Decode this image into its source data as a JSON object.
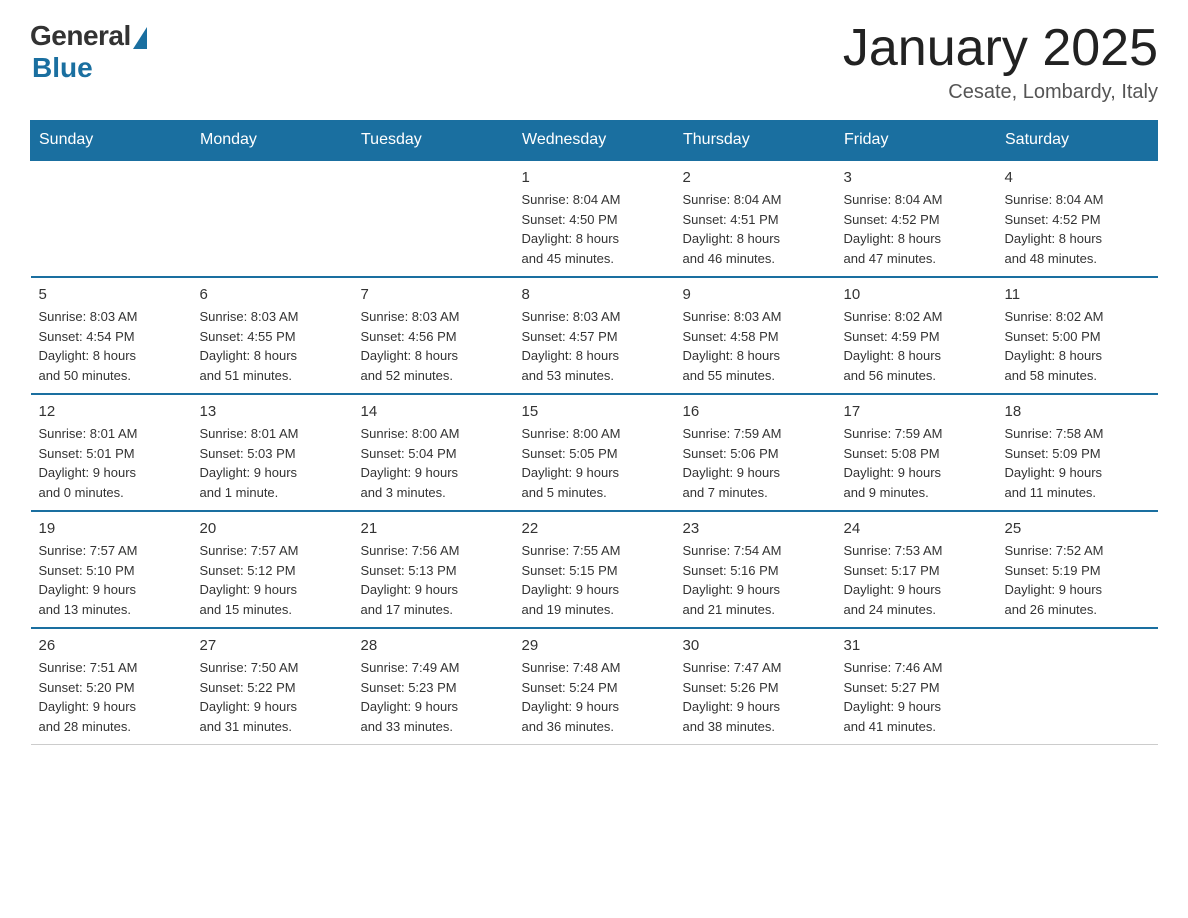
{
  "logo": {
    "general": "General",
    "blue": "Blue"
  },
  "title": "January 2025",
  "location": "Cesate, Lombardy, Italy",
  "days_header": [
    "Sunday",
    "Monday",
    "Tuesday",
    "Wednesday",
    "Thursday",
    "Friday",
    "Saturday"
  ],
  "weeks": [
    [
      {
        "num": "",
        "info": ""
      },
      {
        "num": "",
        "info": ""
      },
      {
        "num": "",
        "info": ""
      },
      {
        "num": "1",
        "info": "Sunrise: 8:04 AM\nSunset: 4:50 PM\nDaylight: 8 hours\nand 45 minutes."
      },
      {
        "num": "2",
        "info": "Sunrise: 8:04 AM\nSunset: 4:51 PM\nDaylight: 8 hours\nand 46 minutes."
      },
      {
        "num": "3",
        "info": "Sunrise: 8:04 AM\nSunset: 4:52 PM\nDaylight: 8 hours\nand 47 minutes."
      },
      {
        "num": "4",
        "info": "Sunrise: 8:04 AM\nSunset: 4:52 PM\nDaylight: 8 hours\nand 48 minutes."
      }
    ],
    [
      {
        "num": "5",
        "info": "Sunrise: 8:03 AM\nSunset: 4:54 PM\nDaylight: 8 hours\nand 50 minutes."
      },
      {
        "num": "6",
        "info": "Sunrise: 8:03 AM\nSunset: 4:55 PM\nDaylight: 8 hours\nand 51 minutes."
      },
      {
        "num": "7",
        "info": "Sunrise: 8:03 AM\nSunset: 4:56 PM\nDaylight: 8 hours\nand 52 minutes."
      },
      {
        "num": "8",
        "info": "Sunrise: 8:03 AM\nSunset: 4:57 PM\nDaylight: 8 hours\nand 53 minutes."
      },
      {
        "num": "9",
        "info": "Sunrise: 8:03 AM\nSunset: 4:58 PM\nDaylight: 8 hours\nand 55 minutes."
      },
      {
        "num": "10",
        "info": "Sunrise: 8:02 AM\nSunset: 4:59 PM\nDaylight: 8 hours\nand 56 minutes."
      },
      {
        "num": "11",
        "info": "Sunrise: 8:02 AM\nSunset: 5:00 PM\nDaylight: 8 hours\nand 58 minutes."
      }
    ],
    [
      {
        "num": "12",
        "info": "Sunrise: 8:01 AM\nSunset: 5:01 PM\nDaylight: 9 hours\nand 0 minutes."
      },
      {
        "num": "13",
        "info": "Sunrise: 8:01 AM\nSunset: 5:03 PM\nDaylight: 9 hours\nand 1 minute."
      },
      {
        "num": "14",
        "info": "Sunrise: 8:00 AM\nSunset: 5:04 PM\nDaylight: 9 hours\nand 3 minutes."
      },
      {
        "num": "15",
        "info": "Sunrise: 8:00 AM\nSunset: 5:05 PM\nDaylight: 9 hours\nand 5 minutes."
      },
      {
        "num": "16",
        "info": "Sunrise: 7:59 AM\nSunset: 5:06 PM\nDaylight: 9 hours\nand 7 minutes."
      },
      {
        "num": "17",
        "info": "Sunrise: 7:59 AM\nSunset: 5:08 PM\nDaylight: 9 hours\nand 9 minutes."
      },
      {
        "num": "18",
        "info": "Sunrise: 7:58 AM\nSunset: 5:09 PM\nDaylight: 9 hours\nand 11 minutes."
      }
    ],
    [
      {
        "num": "19",
        "info": "Sunrise: 7:57 AM\nSunset: 5:10 PM\nDaylight: 9 hours\nand 13 minutes."
      },
      {
        "num": "20",
        "info": "Sunrise: 7:57 AM\nSunset: 5:12 PM\nDaylight: 9 hours\nand 15 minutes."
      },
      {
        "num": "21",
        "info": "Sunrise: 7:56 AM\nSunset: 5:13 PM\nDaylight: 9 hours\nand 17 minutes."
      },
      {
        "num": "22",
        "info": "Sunrise: 7:55 AM\nSunset: 5:15 PM\nDaylight: 9 hours\nand 19 minutes."
      },
      {
        "num": "23",
        "info": "Sunrise: 7:54 AM\nSunset: 5:16 PM\nDaylight: 9 hours\nand 21 minutes."
      },
      {
        "num": "24",
        "info": "Sunrise: 7:53 AM\nSunset: 5:17 PM\nDaylight: 9 hours\nand 24 minutes."
      },
      {
        "num": "25",
        "info": "Sunrise: 7:52 AM\nSunset: 5:19 PM\nDaylight: 9 hours\nand 26 minutes."
      }
    ],
    [
      {
        "num": "26",
        "info": "Sunrise: 7:51 AM\nSunset: 5:20 PM\nDaylight: 9 hours\nand 28 minutes."
      },
      {
        "num": "27",
        "info": "Sunrise: 7:50 AM\nSunset: 5:22 PM\nDaylight: 9 hours\nand 31 minutes."
      },
      {
        "num": "28",
        "info": "Sunrise: 7:49 AM\nSunset: 5:23 PM\nDaylight: 9 hours\nand 33 minutes."
      },
      {
        "num": "29",
        "info": "Sunrise: 7:48 AM\nSunset: 5:24 PM\nDaylight: 9 hours\nand 36 minutes."
      },
      {
        "num": "30",
        "info": "Sunrise: 7:47 AM\nSunset: 5:26 PM\nDaylight: 9 hours\nand 38 minutes."
      },
      {
        "num": "31",
        "info": "Sunrise: 7:46 AM\nSunset: 5:27 PM\nDaylight: 9 hours\nand 41 minutes."
      },
      {
        "num": "",
        "info": ""
      }
    ]
  ]
}
